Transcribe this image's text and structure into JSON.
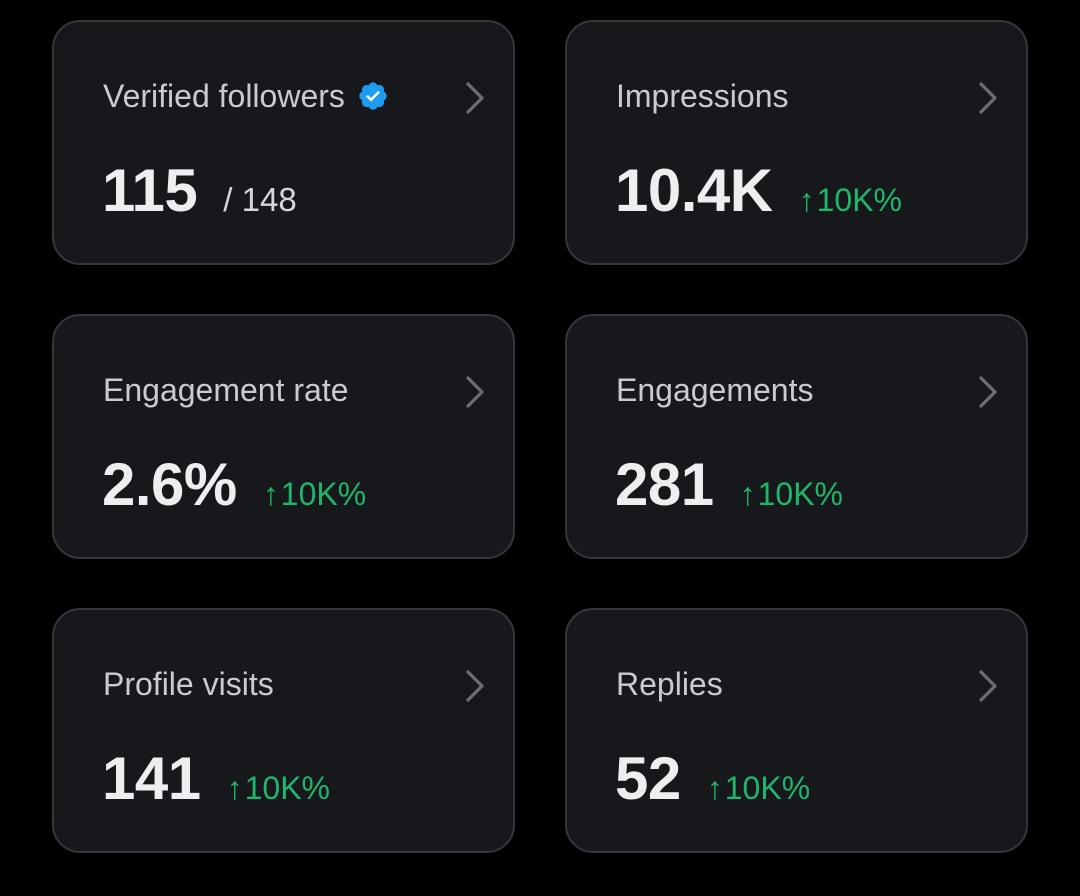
{
  "colors": {
    "background": "#000000",
    "card_background": "#17181c",
    "card_border": "#34363b",
    "title_text": "#c9cbcf",
    "value_text": "#eceef0",
    "positive_change": "#1fb56a",
    "verified_badge": "#1d9bf0",
    "chevron": "#6b6e74"
  },
  "icons": {
    "verified": "verified-badge-icon",
    "chevron": "chevron-right-icon",
    "change_up": "arrow-up-icon"
  },
  "cards": [
    {
      "title": "Verified followers",
      "value": "115",
      "suffix": "/ 148",
      "verified": true
    },
    {
      "title": "Impressions",
      "value": "10.4K",
      "arrow": "↑",
      "change": "10K%"
    },
    {
      "title": "Engagement rate",
      "value": "2.6%",
      "arrow": "↑",
      "change": "10K%"
    },
    {
      "title": "Engagements",
      "value": "281",
      "arrow": "↑",
      "change": "10K%"
    },
    {
      "title": "Profile visits",
      "value": "141",
      "arrow": "↑",
      "change": "10K%"
    },
    {
      "title": "Replies",
      "value": "52",
      "arrow": "↑",
      "change": "10K%"
    }
  ]
}
